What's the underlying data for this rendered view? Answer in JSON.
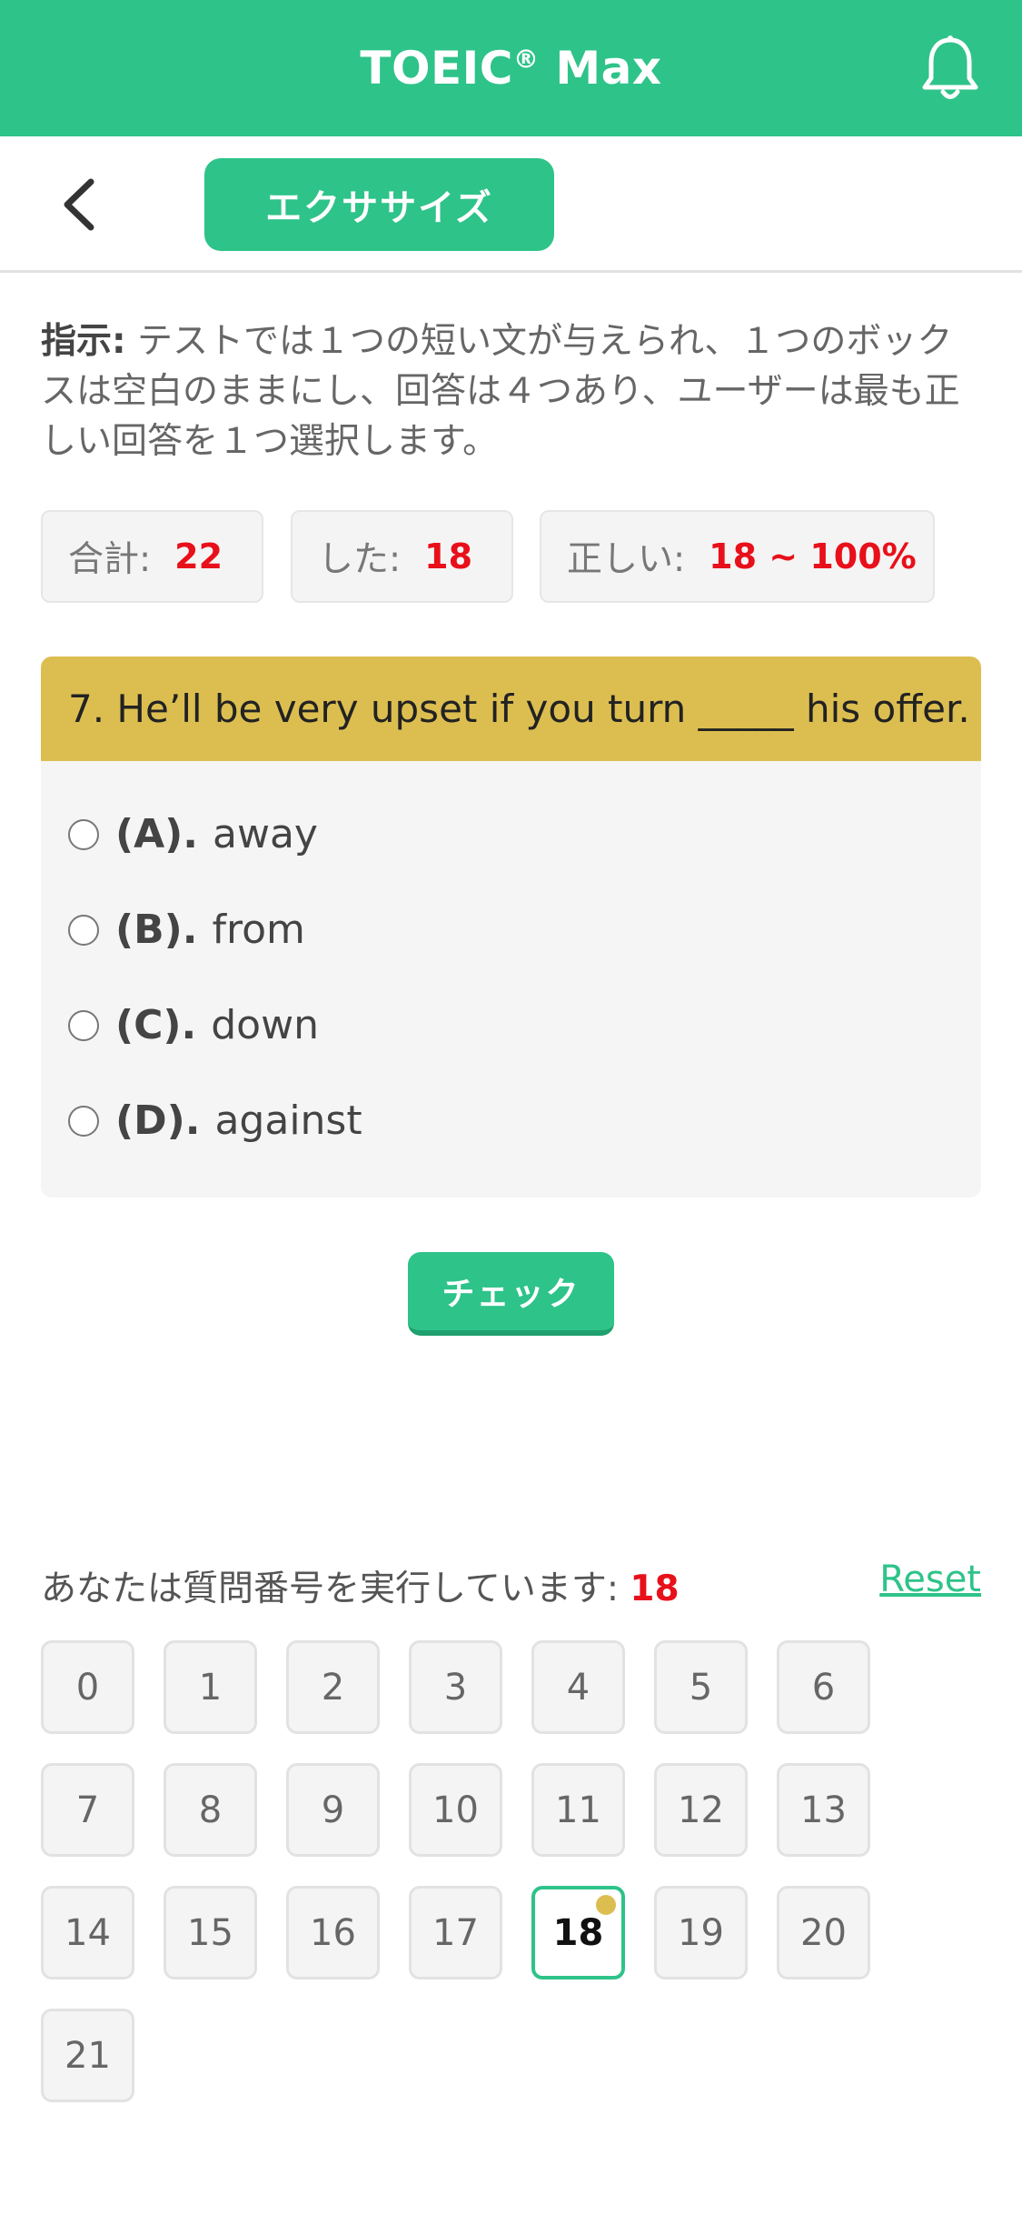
{
  "header": {
    "title": "TOEIC",
    "title_sup": "®",
    "title_suffix": " Max"
  },
  "nav": {
    "exercise_label": "エクササイズ"
  },
  "instructions": {
    "label": "指示:",
    "text": " テストでは１つの短い文が与えられ、１つのボックスは空白のままにし、回答は４つあり、ユーザーは最も正しい回答を１つ選択します。"
  },
  "stats": {
    "total_label": "合計:",
    "total_value": "22",
    "done_label": "した:",
    "done_value": "18",
    "correct_label": "正しい:",
    "correct_value": "18 ~ 100%"
  },
  "question": {
    "text": "7. He’ll be very upset if you turn _____ his offer.",
    "options": [
      {
        "letter": "(A).",
        "text": "away"
      },
      {
        "letter": "(B).",
        "text": "from"
      },
      {
        "letter": "(C).",
        "text": "down"
      },
      {
        "letter": "(D).",
        "text": "against"
      }
    ]
  },
  "check_label": "チェック",
  "progress": {
    "label": "あなたは質問番号を実行しています:",
    "current": "18",
    "reset_label": "Reset"
  },
  "question_numbers": [
    "0",
    "1",
    "2",
    "3",
    "4",
    "5",
    "6",
    "7",
    "8",
    "9",
    "10",
    "11",
    "12",
    "13",
    "14",
    "15",
    "16",
    "17",
    "18",
    "19",
    "20",
    "21"
  ],
  "active_question": "18",
  "colors": {
    "brand": "#2ec389",
    "accent": "#dcbe50",
    "highlight": "#e8101a"
  }
}
